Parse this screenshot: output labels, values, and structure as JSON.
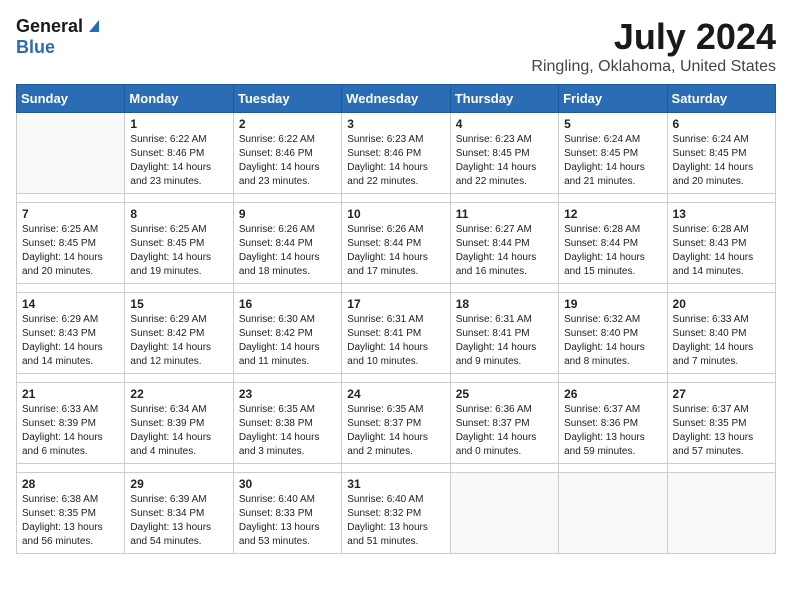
{
  "logo": {
    "line1": "General",
    "line2": "Blue"
  },
  "title": "July 2024",
  "subtitle": "Ringling, Oklahoma, United States",
  "days_of_week": [
    "Sunday",
    "Monday",
    "Tuesday",
    "Wednesday",
    "Thursday",
    "Friday",
    "Saturday"
  ],
  "weeks": [
    [
      {
        "day": "",
        "info": ""
      },
      {
        "day": "1",
        "info": "Sunrise: 6:22 AM\nSunset: 8:46 PM\nDaylight: 14 hours\nand 23 minutes."
      },
      {
        "day": "2",
        "info": "Sunrise: 6:22 AM\nSunset: 8:46 PM\nDaylight: 14 hours\nand 23 minutes."
      },
      {
        "day": "3",
        "info": "Sunrise: 6:23 AM\nSunset: 8:46 PM\nDaylight: 14 hours\nand 22 minutes."
      },
      {
        "day": "4",
        "info": "Sunrise: 6:23 AM\nSunset: 8:45 PM\nDaylight: 14 hours\nand 22 minutes."
      },
      {
        "day": "5",
        "info": "Sunrise: 6:24 AM\nSunset: 8:45 PM\nDaylight: 14 hours\nand 21 minutes."
      },
      {
        "day": "6",
        "info": "Sunrise: 6:24 AM\nSunset: 8:45 PM\nDaylight: 14 hours\nand 20 minutes."
      }
    ],
    [
      {
        "day": "7",
        "info": "Sunrise: 6:25 AM\nSunset: 8:45 PM\nDaylight: 14 hours\nand 20 minutes."
      },
      {
        "day": "8",
        "info": "Sunrise: 6:25 AM\nSunset: 8:45 PM\nDaylight: 14 hours\nand 19 minutes."
      },
      {
        "day": "9",
        "info": "Sunrise: 6:26 AM\nSunset: 8:44 PM\nDaylight: 14 hours\nand 18 minutes."
      },
      {
        "day": "10",
        "info": "Sunrise: 6:26 AM\nSunset: 8:44 PM\nDaylight: 14 hours\nand 17 minutes."
      },
      {
        "day": "11",
        "info": "Sunrise: 6:27 AM\nSunset: 8:44 PM\nDaylight: 14 hours\nand 16 minutes."
      },
      {
        "day": "12",
        "info": "Sunrise: 6:28 AM\nSunset: 8:44 PM\nDaylight: 14 hours\nand 15 minutes."
      },
      {
        "day": "13",
        "info": "Sunrise: 6:28 AM\nSunset: 8:43 PM\nDaylight: 14 hours\nand 14 minutes."
      }
    ],
    [
      {
        "day": "14",
        "info": "Sunrise: 6:29 AM\nSunset: 8:43 PM\nDaylight: 14 hours\nand 14 minutes."
      },
      {
        "day": "15",
        "info": "Sunrise: 6:29 AM\nSunset: 8:42 PM\nDaylight: 14 hours\nand 12 minutes."
      },
      {
        "day": "16",
        "info": "Sunrise: 6:30 AM\nSunset: 8:42 PM\nDaylight: 14 hours\nand 11 minutes."
      },
      {
        "day": "17",
        "info": "Sunrise: 6:31 AM\nSunset: 8:41 PM\nDaylight: 14 hours\nand 10 minutes."
      },
      {
        "day": "18",
        "info": "Sunrise: 6:31 AM\nSunset: 8:41 PM\nDaylight: 14 hours\nand 9 minutes."
      },
      {
        "day": "19",
        "info": "Sunrise: 6:32 AM\nSunset: 8:40 PM\nDaylight: 14 hours\nand 8 minutes."
      },
      {
        "day": "20",
        "info": "Sunrise: 6:33 AM\nSunset: 8:40 PM\nDaylight: 14 hours\nand 7 minutes."
      }
    ],
    [
      {
        "day": "21",
        "info": "Sunrise: 6:33 AM\nSunset: 8:39 PM\nDaylight: 14 hours\nand 6 minutes."
      },
      {
        "day": "22",
        "info": "Sunrise: 6:34 AM\nSunset: 8:39 PM\nDaylight: 14 hours\nand 4 minutes."
      },
      {
        "day": "23",
        "info": "Sunrise: 6:35 AM\nSunset: 8:38 PM\nDaylight: 14 hours\nand 3 minutes."
      },
      {
        "day": "24",
        "info": "Sunrise: 6:35 AM\nSunset: 8:37 PM\nDaylight: 14 hours\nand 2 minutes."
      },
      {
        "day": "25",
        "info": "Sunrise: 6:36 AM\nSunset: 8:37 PM\nDaylight: 14 hours\nand 0 minutes."
      },
      {
        "day": "26",
        "info": "Sunrise: 6:37 AM\nSunset: 8:36 PM\nDaylight: 13 hours\nand 59 minutes."
      },
      {
        "day": "27",
        "info": "Sunrise: 6:37 AM\nSunset: 8:35 PM\nDaylight: 13 hours\nand 57 minutes."
      }
    ],
    [
      {
        "day": "28",
        "info": "Sunrise: 6:38 AM\nSunset: 8:35 PM\nDaylight: 13 hours\nand 56 minutes."
      },
      {
        "day": "29",
        "info": "Sunrise: 6:39 AM\nSunset: 8:34 PM\nDaylight: 13 hours\nand 54 minutes."
      },
      {
        "day": "30",
        "info": "Sunrise: 6:40 AM\nSunset: 8:33 PM\nDaylight: 13 hours\nand 53 minutes."
      },
      {
        "day": "31",
        "info": "Sunrise: 6:40 AM\nSunset: 8:32 PM\nDaylight: 13 hours\nand 51 minutes."
      },
      {
        "day": "",
        "info": ""
      },
      {
        "day": "",
        "info": ""
      },
      {
        "day": "",
        "info": ""
      }
    ]
  ]
}
